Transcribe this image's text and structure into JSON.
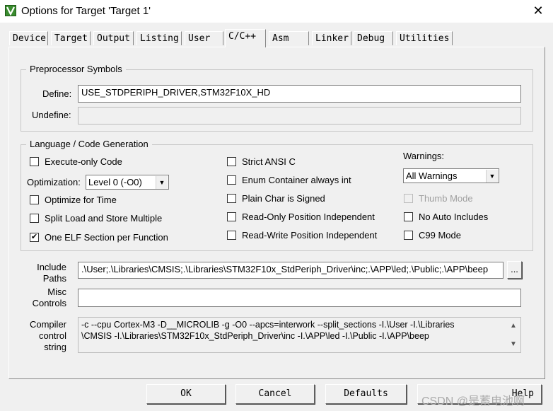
{
  "window": {
    "title": "Options for Target 'Target 1'",
    "close_glyph": "✕"
  },
  "tabs": [
    "Device",
    "Target",
    "Output",
    "Listing",
    "User",
    "C/C++",
    "Asm",
    "Linker",
    "Debug",
    "Utilities"
  ],
  "active_tab": "C/C++",
  "preprocessor": {
    "group_label": "Preprocessor Symbols",
    "define_label": "Define:",
    "define_value": "USE_STDPERIPH_DRIVER,STM32F10X_HD",
    "undefine_label": "Undefine:",
    "undefine_value": ""
  },
  "codegen": {
    "group_label": "Language / Code Generation",
    "execute_only": {
      "label": "Execute-only Code",
      "checked": false
    },
    "optimization_label": "Optimization:",
    "optimization_value": "Level 0 (-O0)",
    "optimize_time": {
      "label": "Optimize for Time",
      "checked": false
    },
    "split_load": {
      "label": "Split Load and Store Multiple",
      "checked": false
    },
    "one_elf": {
      "label": "One ELF Section per Function",
      "checked": true
    },
    "strict_ansi": {
      "label": "Strict ANSI C",
      "checked": false
    },
    "enum_container": {
      "label": "Enum Container always int",
      "checked": false
    },
    "plain_char": {
      "label": "Plain Char is Signed",
      "checked": false
    },
    "ro_position": {
      "label": "Read-Only Position Independent",
      "checked": false
    },
    "rw_position": {
      "label": "Read-Write Position Independent",
      "checked": false
    },
    "warnings_label": "Warnings:",
    "warnings_value": "All Warnings",
    "thumb_mode": {
      "label": "Thumb Mode",
      "checked": false,
      "disabled": true
    },
    "no_auto_includes": {
      "label": "No Auto Includes",
      "checked": false
    },
    "c99_mode": {
      "label": "C99 Mode",
      "checked": false
    }
  },
  "paths": {
    "include_label_1": "Include",
    "include_label_2": "Paths",
    "include_value": ".\\User;.\\Libraries\\CMSIS;.\\Libraries\\STM32F10x_StdPeriph_Driver\\inc;.\\APP\\led;.\\Public;.\\APP\\beep",
    "browse_label": "...",
    "misc_label_1": "Misc",
    "misc_label_2": "Controls",
    "misc_value": "",
    "compiler_label_1": "Compiler",
    "compiler_label_2": "control",
    "compiler_label_3": "string",
    "compiler_line_1": "-c --cpu Cortex-M3 -D__MICROLIB -g -O0 --apcs=interwork --split_sections -I.\\User -I.\\Libraries",
    "compiler_line_2": "\\CMSIS -I.\\Libraries\\STM32F10x_StdPeriph_Driver\\inc -I.\\APP\\led -I.\\Public -I.\\APP\\beep"
  },
  "buttons": {
    "ok": "OK",
    "cancel": "Cancel",
    "defaults": "Defaults",
    "help": "Help"
  },
  "watermark": "CSDN @是蓄电池啊",
  "colors": {
    "icon_green": "#3a8c2f",
    "dialog_bg": "#f0f0f0"
  }
}
